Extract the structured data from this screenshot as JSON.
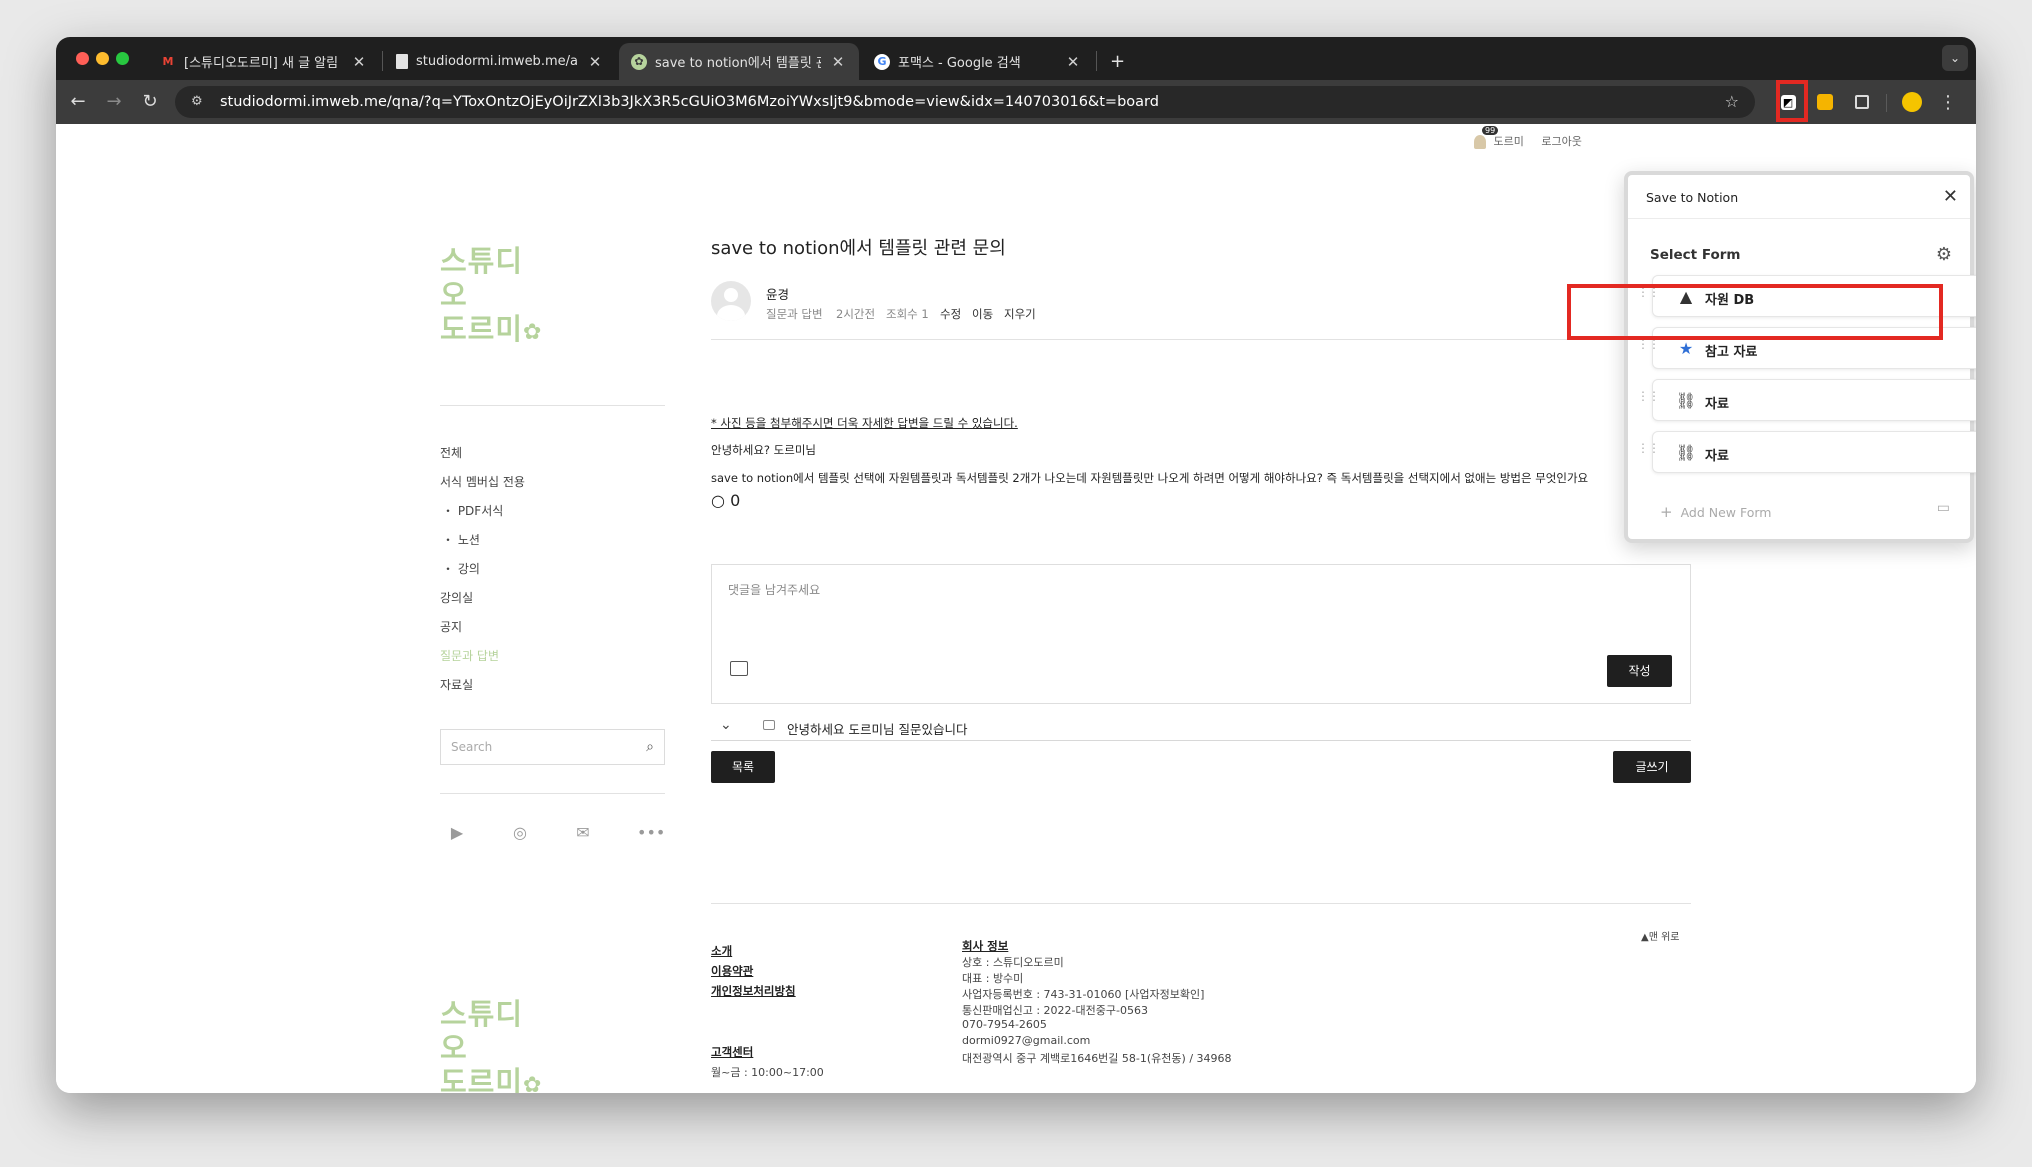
{
  "browser": {
    "tabs": [
      {
        "title": "[스튜디오도르미] 새 글 알림 - 문의",
        "favicon": "M"
      },
      {
        "title": "studiodormi.imweb.me/admin",
        "favicon": "page"
      },
      {
        "title": "save to notion에서 템플릿 관련 문의",
        "favicon": "✿"
      },
      {
        "title": "포맥스 - Google 검색",
        "favicon": "G"
      }
    ],
    "new_tab": "+",
    "url": "studiodormi.imweb.me/qna/?q=YToxOntzOjEyOiJrZXl3b3JkX3R5cGUiO3M6MzoiYWxsIjt9&bmode=view&idx=140703016&t=board"
  },
  "site": {
    "brand_line1": "스튜디오",
    "brand_line2": "도르미",
    "brand_mark": "✿",
    "top_util": {
      "badge": "99",
      "user": "도르미",
      "logout": "로그아웃"
    },
    "sidebar": [
      {
        "label": "전체",
        "active": false
      },
      {
        "label": "서식 멤버십 전용",
        "active": false
      },
      {
        "label": "・ PDF서식",
        "active": false
      },
      {
        "label": "・ 노션",
        "active": false
      },
      {
        "label": "・ 강의",
        "active": false
      },
      {
        "label": "강의실",
        "active": false
      },
      {
        "label": "공지",
        "active": false
      },
      {
        "label": "질문과 답변",
        "active": true
      },
      {
        "label": "자료실",
        "active": false
      }
    ],
    "search_placeholder": "Search",
    "accent_color": "#b6d39c"
  },
  "post": {
    "title": "save to notion에서 템플릿 관련 문의",
    "author": "윤경",
    "category": "질문과 답변",
    "time": "2시간전",
    "views": "조회수 1",
    "actions": [
      "수정",
      "이동",
      "지우기"
    ],
    "notice": "* 사진 등을 첨부해주시면 더욱 자세한 답변을 드릴 수 있습니다.",
    "greeting": "안녕하세요? 도르미님",
    "body": "save to notion에서 템플릿 선택에 자원템플릿과 독서템플릿 2개가 나오는데 자원템플릿만 나오게 하려면 어떻게 해야하나요? 즉 독서템플릿을 선택지에서 없애는 방법은 무엇인가요",
    "comment_count": "0",
    "comment_placeholder": "댓글을 남겨주세요",
    "submit_label": "작성",
    "related_post": "안녕하세요 도르미님 질문있습니다",
    "list_button": "목록",
    "write_button": "글쓰기"
  },
  "footer": {
    "links": [
      "소개",
      "이용약관",
      "개인정보처리방침"
    ],
    "cs_title": "고객센터",
    "cs_hours": "월~금 : 10:00~17:00",
    "company_title": "회사 정보",
    "company_lines": [
      "상호 : 스튜디오도르미",
      "대표 : 방수미",
      "사업자등록번호 : 743-31-01060 [사업자정보확인]",
      "통신판매업신고 : 2022-대전중구-0563",
      "070-7954-2605",
      "dormi0927@gmail.com",
      "대전광역시 중구 계백로1646번길 58-1(유천동) / 34968"
    ],
    "to_top": "▲맨 위로"
  },
  "extension": {
    "title": "Save to Notion",
    "select_label": "Select Form",
    "forms": [
      {
        "label": "자원 DB",
        "icon": "triangle-icon"
      },
      {
        "label": "참고 자료",
        "icon": "star-icon"
      },
      {
        "label": "자료",
        "icon": "link-icon"
      },
      {
        "label": "자료",
        "icon": "link-icon"
      }
    ],
    "add_label": "Add New Form",
    "highlight_color": "#e32922"
  }
}
